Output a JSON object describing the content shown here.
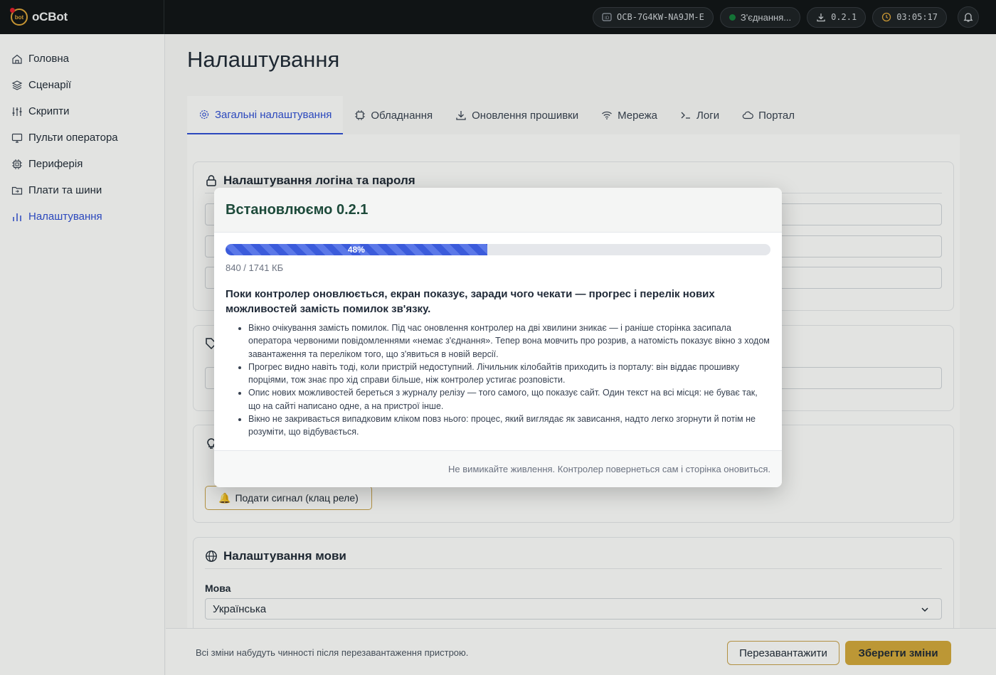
{
  "app": {
    "name": "oCBot",
    "logo_text": "bot"
  },
  "topbar": {
    "device_id": "OCB-7G4KW-NA9JM-E",
    "connection": "З'єднання...",
    "version": "0.2.1",
    "uptime": "03:05:17"
  },
  "sidebar": {
    "items": [
      {
        "label": "Головна"
      },
      {
        "label": "Сценарії"
      },
      {
        "label": "Скрипти"
      },
      {
        "label": "Пульти оператора"
      },
      {
        "label": "Периферія"
      },
      {
        "label": "Плати та шини"
      },
      {
        "label": "Налаштування"
      }
    ]
  },
  "main": {
    "title": "Налаштування",
    "tabs": [
      {
        "label": "Загальні налаштування"
      },
      {
        "label": "Обладнання"
      },
      {
        "label": "Оновлення прошивки"
      },
      {
        "label": "Мережа"
      },
      {
        "label": "Логи"
      },
      {
        "label": "Портал"
      }
    ],
    "login_card_title": "Налаштування логіна та пароля",
    "beep_button": "Подати сигнал (клац реле)",
    "language_card_title": "Налаштування мови",
    "language_label": "Мова",
    "language_value": "Українська",
    "footer_note": "Всі зміни набудуть чинності після перезавантаження пристрою.",
    "reboot_button": "Перезавантажити",
    "save_button": "Зберегти зміни"
  },
  "modal": {
    "title": "Встановлюємо 0.2.1",
    "progress": {
      "percent": 48,
      "label": "48%"
    },
    "size_text": "840 / 1741 КБ",
    "lead": "Поки контролер оновлюється, екран показує, заради чого чекати — прогрес і перелік нових можливостей замість помилок зв'язку.",
    "bullets": [
      "Вікно очікування замість помилок. Під час оновлення контролер на дві хвилини зникає — і раніше сторінка засипала оператора червоними повідомленнями «немає з'єднання». Тепер вона мовчить про розрив, а натомість показує вікно з ходом завантаження та переліком того, що з'явиться в новій версії.",
      "Прогрес видно навіть тоді, коли пристрій недоступний. Лічильник кілобайтів приходить із порталу: він віддає прошивку порціями, тож знає про хід справи більше, ніж контролер устигає розповісти.",
      "Опис нових можливостей береться з журналу релізу — того самого, що показує сайт. Один текст на всі місця: не буває так, що на сайті написано одне, а на пристрої інше.",
      "Вікно не закривається випадковим кліком повз нього: процес, який виглядає як зависання, надто легко згорнути й потім не розуміти, що відбувається."
    ],
    "footer_note": "Не вимикайте живлення. Контролер повернеться сам і сторінка оновиться."
  },
  "colors": {
    "accent": "#2f4fd6",
    "gold": "#d4a93c",
    "modal_title": "#1d4a3a"
  }
}
